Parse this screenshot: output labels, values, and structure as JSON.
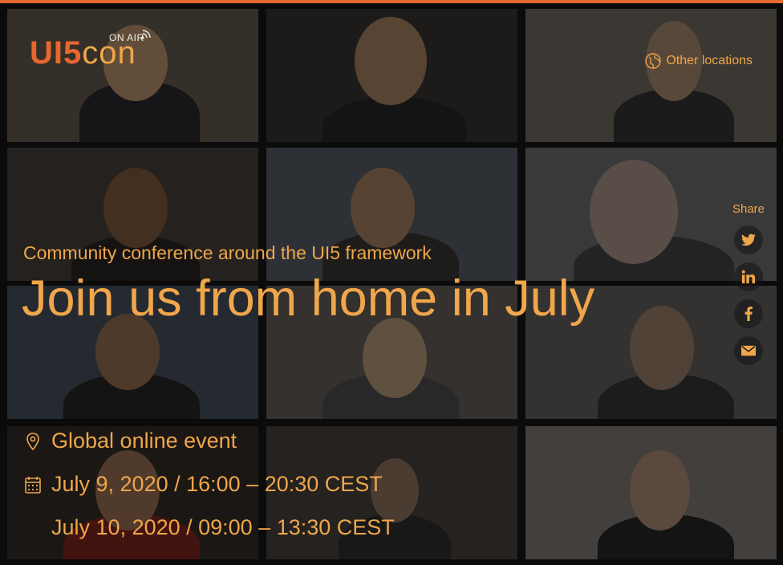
{
  "colors": {
    "accent": "#f0a64a",
    "brand": "#e8672f",
    "background": "#0b0b0b"
  },
  "logo": {
    "brand_ui": "UI5",
    "brand_con": "con",
    "badge": "ON AIR"
  },
  "header": {
    "other_locations": "Other locations",
    "other_locations_icon": "globe-icon"
  },
  "share": {
    "label": "Share",
    "items": [
      {
        "name": "twitter",
        "icon": "twitter-icon"
      },
      {
        "name": "linkedin",
        "icon": "linkedin-icon"
      },
      {
        "name": "facebook",
        "icon": "facebook-icon"
      },
      {
        "name": "email",
        "icon": "mail-icon"
      }
    ]
  },
  "hero": {
    "subtitle": "Community conference around the UI5 framework",
    "headline": "Join us from home in July"
  },
  "event": {
    "location": "Global online event",
    "location_icon": "map-pin-icon",
    "date_icon": "calendar-icon",
    "dates": [
      "July 9, 2020 / 16:00 – 20:30 CEST",
      "July 10, 2020 / 09:00 – 13:30 CEST"
    ]
  }
}
